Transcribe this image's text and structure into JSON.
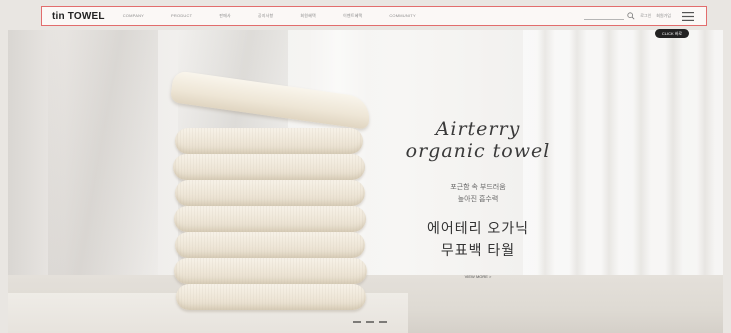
{
  "header": {
    "logo": "tin TOWEL",
    "nav": [
      "COMPANY",
      "PRODUCT",
      "판매사",
      "공지사항",
      "회원혜택",
      "이벤트혜택",
      "COMMUNITY"
    ],
    "utility": [
      "로그인",
      "회원가입"
    ],
    "badge": "CLICK 바로"
  },
  "hero": {
    "script_title_line1": "Airterry",
    "script_title_line2": "organic towel",
    "subcopy_line1": "포근함 속 부드러움",
    "subcopy_line2": "높아진 흡수력",
    "headline_line1": "에어테리 오가닉",
    "headline_line2": "무표백 타월",
    "more_label": "VIEW MORE >"
  },
  "colors": {
    "header_border": "#e26d6d",
    "text_dark": "#333333",
    "towel": "#eee6d7"
  },
  "icons": [
    "search-icon",
    "menu-icon"
  ]
}
